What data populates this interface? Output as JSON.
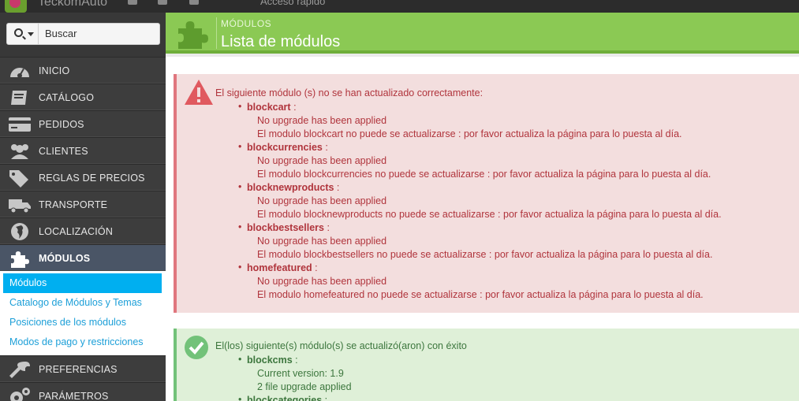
{
  "topbar": {
    "shop_name": "TeckomAuto",
    "quick_access": "Acceso rápido"
  },
  "search": {
    "placeholder": "Buscar"
  },
  "sidebar": {
    "items": [
      {
        "label": "INICIO",
        "icon": "dashboard-icon"
      },
      {
        "label": "CATÁLOGO",
        "icon": "book-icon"
      },
      {
        "label": "PEDIDOS",
        "icon": "credit-card-icon"
      },
      {
        "label": "CLIENTES",
        "icon": "users-icon"
      },
      {
        "label": "REGLAS DE PRECIOS",
        "icon": "tags-icon"
      },
      {
        "label": "TRANSPORTE",
        "icon": "truck-icon"
      },
      {
        "label": "LOCALIZACIÓN",
        "icon": "globe-icon"
      },
      {
        "label": "MÓDULOS",
        "icon": "puzzle-icon"
      }
    ],
    "submenu": [
      "Módulos",
      "Catalogo de Módulos y Temas",
      "Posiciones de los módulos",
      "Modos de pago y restricciones"
    ],
    "bottom_items": [
      {
        "label": "PREFERENCIAS",
        "icon": "wrench-icon"
      },
      {
        "label": "PARÁMETROS AVANZADOS",
        "icon": "cogs-icon"
      }
    ]
  },
  "header": {
    "breadcrumb": "MÓDULOS",
    "title": "Lista de módulos"
  },
  "colors": {
    "header_green": "#8bc954",
    "danger_bg": "#f3dede",
    "danger_text": "#b0343c",
    "success_bg": "#dff0d8",
    "success_text": "#3c763d",
    "submenu_active": "#00aff0"
  },
  "error_alert": {
    "lead": "El siguiente módulo (s) no se han actualizado correctamente:",
    "modules": [
      {
        "name": "blockcart",
        "lines": [
          "No upgrade has been applied",
          "El modulo blockcart no puede se actualizarse : por favor actualiza la página para lo puesta al día."
        ]
      },
      {
        "name": "blockcurrencies",
        "lines": [
          "No upgrade has been applied",
          "El modulo blockcurrencies no puede se actualizarse : por favor actualiza la página para lo puesta al día."
        ]
      },
      {
        "name": "blocknewproducts",
        "lines": [
          "No upgrade has been applied",
          "El modulo blocknewproducts no puede se actualizarse : por favor actualiza la página para lo puesta al día."
        ]
      },
      {
        "name": "blockbestsellers",
        "lines": [
          "No upgrade has been applied",
          "El modulo blockbestsellers no puede se actualizarse : por favor actualiza la página para lo puesta al día."
        ]
      },
      {
        "name": "homefeatured",
        "lines": [
          "No upgrade has been applied",
          "El modulo homefeatured no puede se actualizarse : por favor actualiza la página para lo puesta al día."
        ]
      }
    ]
  },
  "success_alert": {
    "lead": "El(los) siguiente(s) módulo(s) se actualizó(aron) con éxito",
    "modules": [
      {
        "name": "blockcms",
        "lines": [
          "Current version: 1.9",
          "2 file upgrade applied"
        ]
      },
      {
        "name": "blockcategories",
        "lines": []
      }
    ]
  }
}
